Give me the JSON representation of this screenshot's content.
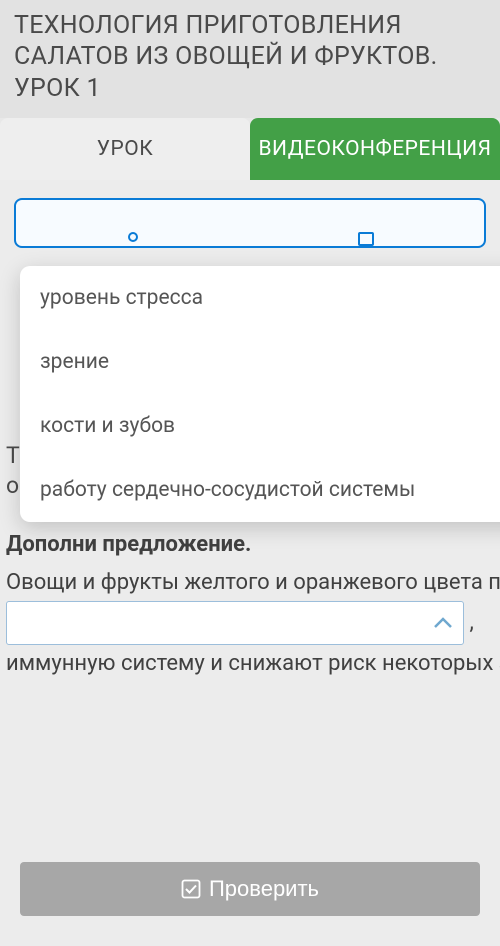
{
  "header": {
    "title_line1": "ТЕХНОЛОГИЯ ПРИГОТОВЛЕНИЯ",
    "title_line2": "САЛАТОВ ИЗ ОВОЩЕЙ И ФРУКТОВ.",
    "title_line3": "УРОК 1"
  },
  "tabs": {
    "lesson": "УРОК",
    "video": "ВИДЕОКОНФЕРЕНЦИЯ"
  },
  "hidden": {
    "t": "Т",
    "o": "о"
  },
  "dropdown": {
    "items": [
      "уровень стресса",
      "зрение",
      "кости и зубов",
      "работу сердечно-сосудистой системы"
    ]
  },
  "task": {
    "title": "Дополни предложение.",
    "before": "Овощи и фрукты желтого и оранжевого цвета помогают поддерживать сердечную деятельность,",
    "after_comma": ",",
    "after": "иммунную систему и снижают риск некоторых злокачественных заболеваний."
  },
  "button": {
    "check": "Проверить"
  }
}
